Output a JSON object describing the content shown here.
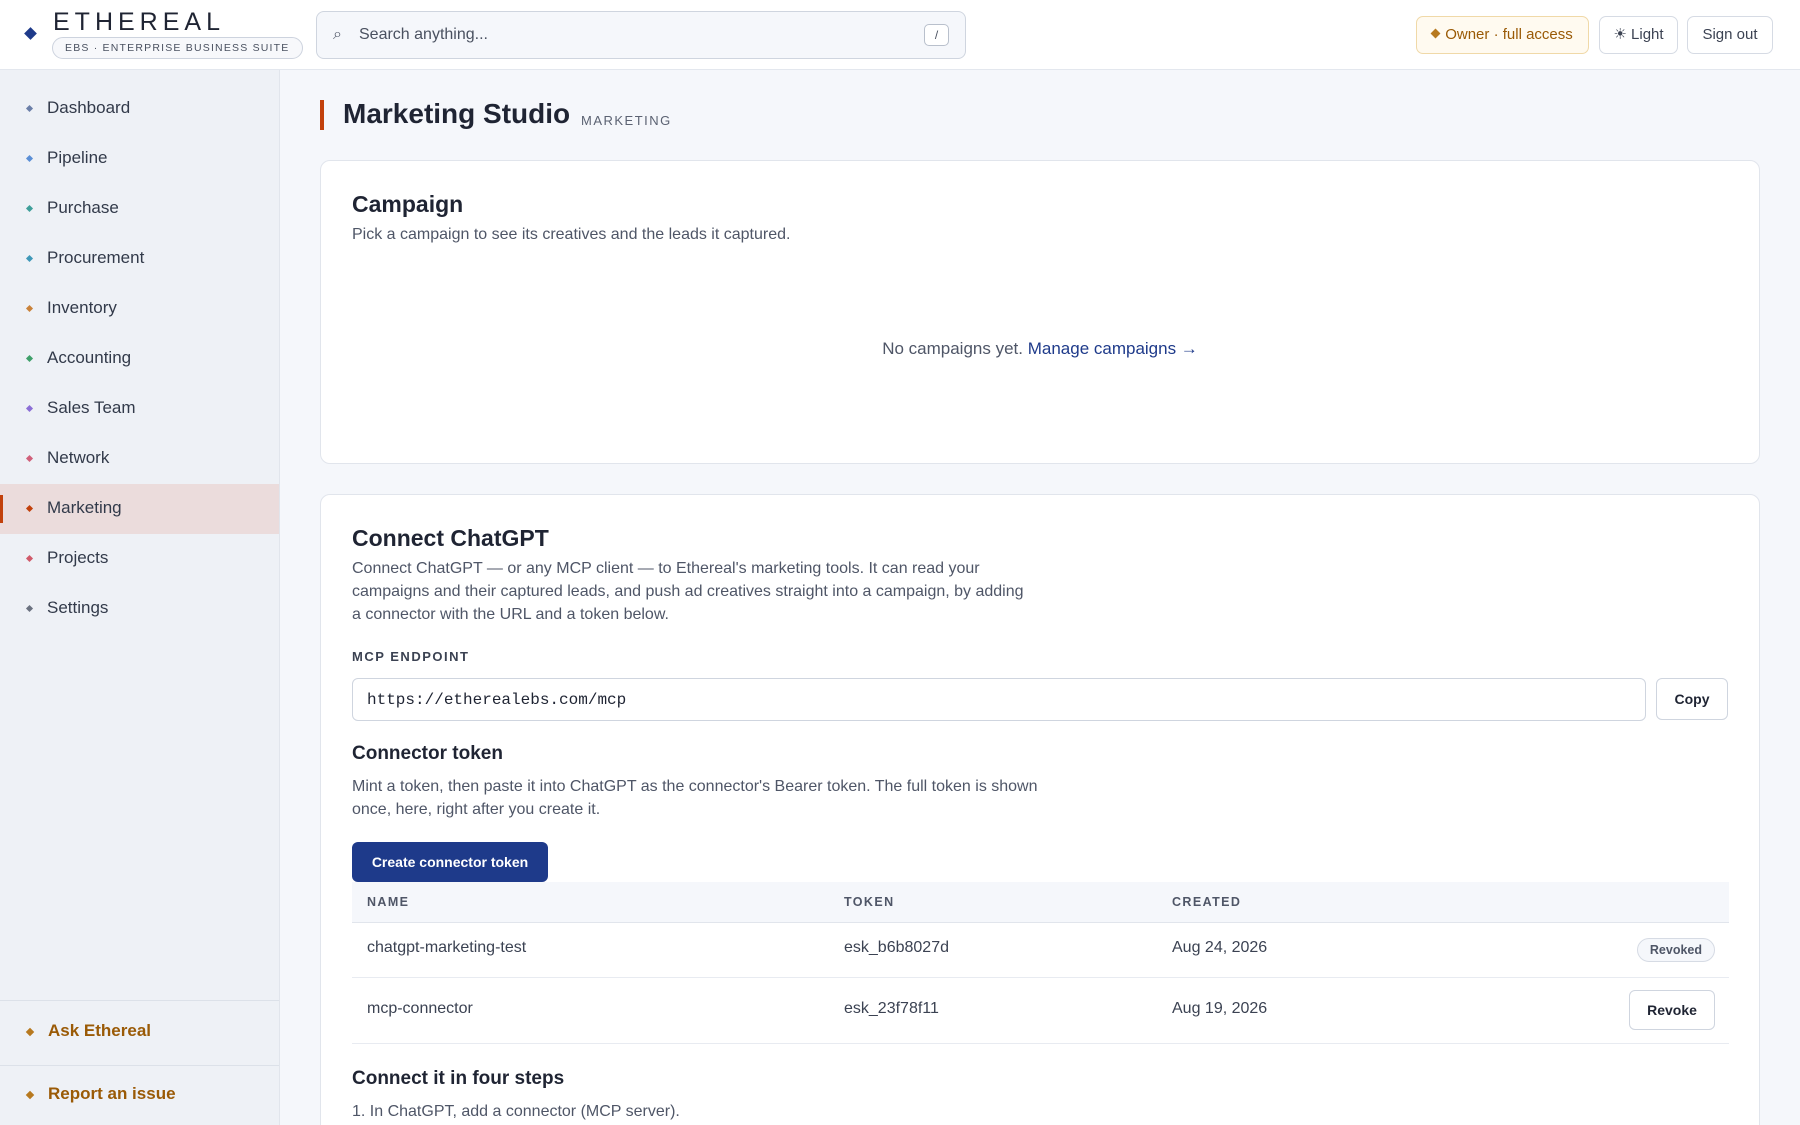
{
  "header": {
    "brand_name": "ETHEREAL",
    "brand_sub": "EBS · ENTERPRISE BUSINESS SUITE",
    "search_placeholder": "Search anything...",
    "search_shortcut": "/",
    "owner_label": "Owner · full access",
    "theme_label": "☀ Light",
    "signout_label": "Sign out"
  },
  "sidebar": {
    "items": [
      {
        "label": "Dashboard",
        "color": "#6b7fa8"
      },
      {
        "label": "Pipeline",
        "color": "#5b8fd6"
      },
      {
        "label": "Purchase",
        "color": "#3f9f9a"
      },
      {
        "label": "Procurement",
        "color": "#3f98b8"
      },
      {
        "label": "Inventory",
        "color": "#c9823a"
      },
      {
        "label": "Accounting",
        "color": "#3fa06a"
      },
      {
        "label": "Sales Team",
        "color": "#8b6fd6"
      },
      {
        "label": "Network",
        "color": "#d0607a"
      },
      {
        "label": "Marketing",
        "color": "#c2410c"
      },
      {
        "label": "Projects",
        "color": "#d05a6a"
      },
      {
        "label": "Settings",
        "color": "#6b7280"
      }
    ],
    "footer": [
      {
        "label": "Ask Ethereal"
      },
      {
        "label": "Report an issue"
      }
    ]
  },
  "page": {
    "title": "Marketing Studio",
    "tag": "MARKETING"
  },
  "campaign": {
    "title": "Campaign",
    "description": "Pick a campaign to see its creatives and the leads it captured.",
    "empty_text": "No campaigns yet.",
    "empty_link": "Manage campaigns →"
  },
  "connect": {
    "title": "Connect ChatGPT",
    "description": "Connect ChatGPT — or any MCP client — to Ethereal's marketing tools. It can read your campaigns and their captured leads, and push ad creatives straight into a campaign, by adding a connector with the URL and a token below.",
    "endpoint_label": "MCP ENDPOINT",
    "endpoint_value": "https://etherealebs.com/mcp",
    "copy_label": "Copy",
    "token_title": "Connector token",
    "token_description": "Mint a token, then paste it into ChatGPT as the connector's Bearer token. The full token is shown once, here, right after you create it.",
    "create_label": "Create connector token",
    "table": {
      "headers": [
        "NAME",
        "TOKEN",
        "CREATED"
      ],
      "rows": [
        {
          "name": "chatgpt-marketing-test",
          "token": "esk_b6b8027d",
          "created": "Aug 24, 2026",
          "status": "Revoked"
        },
        {
          "name": "mcp-connector",
          "token": "esk_23f78f11",
          "created": "Aug 19, 2026",
          "action": "Revoke"
        }
      ]
    },
    "steps_title": "Connect it in four steps",
    "steps": [
      "1. In ChatGPT, add a connector (MCP server)."
    ]
  },
  "colors": {
    "accent": "#c2410c",
    "primary": "#1e3a8a",
    "gold": "#b7791f"
  }
}
